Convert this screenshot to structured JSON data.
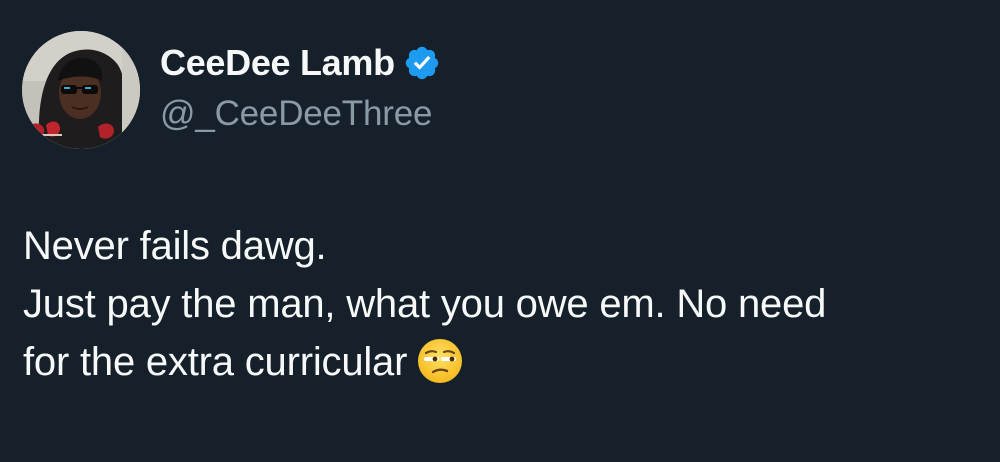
{
  "author": {
    "display_name": "CeeDee Lamb",
    "handle": "@_CeeDeeThree",
    "verified": true,
    "avatar_icon": "profile-photo-avatar",
    "verified_icon": "verified-badge-icon",
    "verified_color": "#1d9bf0"
  },
  "tweet": {
    "lines": [
      "Never fails dawg.",
      "Just pay the man, what you owe em. No need",
      "for the extra curricular"
    ],
    "emoji": "unamused-face-emoji"
  },
  "colors": {
    "background": "#15202b",
    "primary_text": "#f7f9f9",
    "secondary_text": "#8b98a5"
  }
}
